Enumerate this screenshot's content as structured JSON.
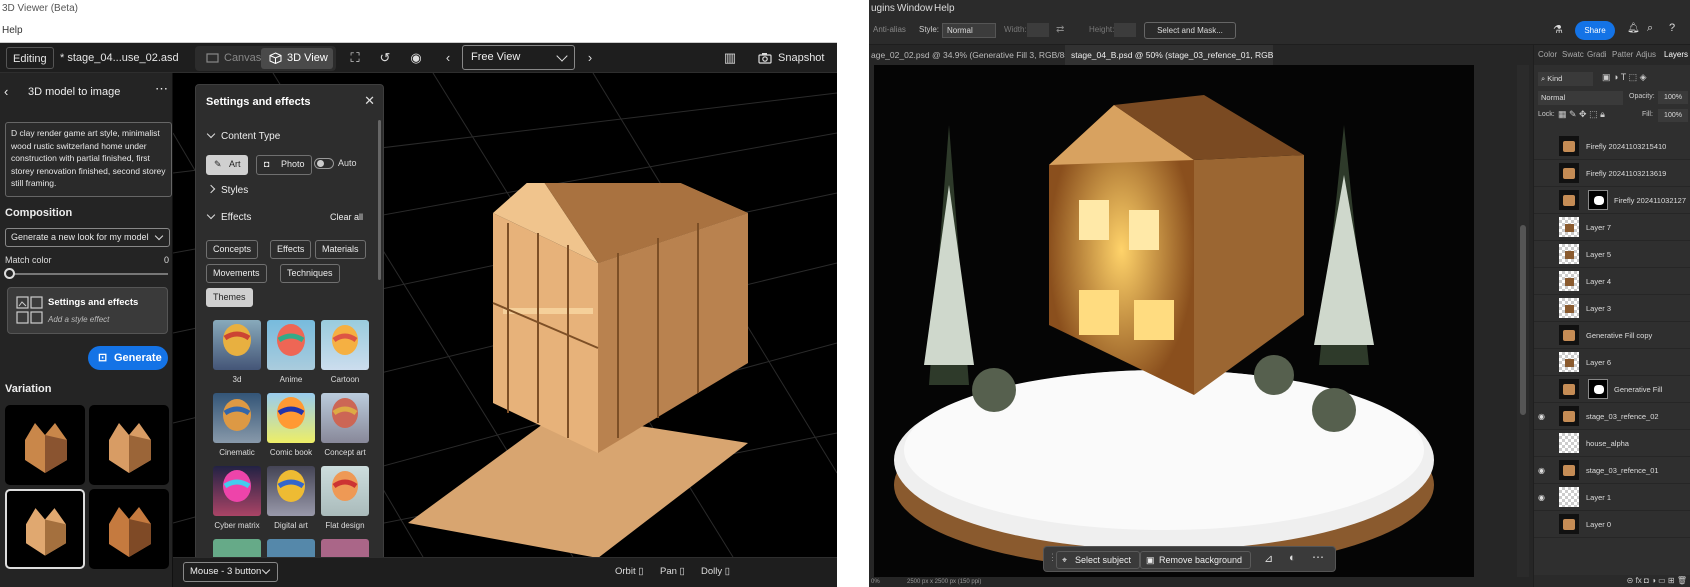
{
  "left_app": {
    "window_title": "3D Viewer (Beta)",
    "menu": [
      "Help"
    ],
    "toolbar": {
      "mode_label": "Editing",
      "file_name": "* stage_04...use_02.asd",
      "canvas_label": "Canvas",
      "view3d_label": "3D View",
      "camera_view": "Free View",
      "snapshot_label": "Snapshot"
    },
    "panel": {
      "title": "3D model to image",
      "prompt": "D clay render game art style, minimalist wood rustic switzerland home under construction with partial finished, first storey renovation finished, second storey still framing.",
      "composition_title": "Composition",
      "composition_select": "Generate a new look for my model",
      "match_color_label": "Match color",
      "match_color_value": "0",
      "settings_card_title": "Settings and effects",
      "settings_card_sub": "Add a style effect",
      "generate_label": "Generate",
      "variation_title": "Variation"
    },
    "settings_popup": {
      "title": "Settings and effects",
      "content_type_title": "Content Type",
      "art_label": "Art",
      "photo_label": "Photo",
      "auto_label": "Auto",
      "styles_title": "Styles",
      "effects_title": "Effects",
      "clear_all_label": "Clear all",
      "effect_chips": [
        "Concepts",
        "Effects",
        "Materials",
        "Movements",
        "Techniques",
        "Themes"
      ],
      "tiles": [
        {
          "label": "3d"
        },
        {
          "label": "Anime"
        },
        {
          "label": "Cartoon"
        },
        {
          "label": "Cinematic"
        },
        {
          "label": "Comic book"
        },
        {
          "label": "Concept art"
        },
        {
          "label": "Cyber matrix"
        },
        {
          "label": "Digital art"
        },
        {
          "label": "Flat design"
        }
      ]
    },
    "bottom": {
      "input_select": "Mouse - 3 button",
      "orbit_label": "Orbit",
      "pan_label": "Pan",
      "dolly_label": "Dolly"
    }
  },
  "right_app": {
    "menu": [
      "ugins",
      "Window",
      "Help"
    ],
    "options": {
      "anti_alias": "Anti-alias",
      "style_label": "Style:",
      "style_value": "Normal",
      "width_label": "Width:",
      "height_label": "Height:",
      "select_mask_label": "Select and Mask...",
      "share_label": "Share"
    },
    "doc_tabs": [
      "age_02_02.psd @ 34.9% (Generative Fill 3, RGB/8#) *",
      "stage_04_B.psd @ 50% (stage_03_refence_01, RGB/8#) *"
    ],
    "context_bar": {
      "select_subject_label": "Select subject",
      "remove_background_label": "Remove background"
    },
    "status": {
      "zoom": "0%",
      "doc_size": "2500 px x 2500 px (150 ppi)"
    },
    "layers_panel": {
      "tabs": [
        "Color",
        "Swatc",
        "Gradi",
        "Patter",
        "Adjus",
        "Layers"
      ],
      "kind_label": "Kind",
      "blend_mode": "Normal",
      "opacity_label": "Opacity:",
      "opacity_value": "100%",
      "lock_label": "Lock:",
      "fill_label": "Fill:",
      "fill_value": "100%",
      "layers": [
        {
          "name": "Firefly 20241103215410",
          "visible": false,
          "thumb": "house"
        },
        {
          "name": "Firefly 20241103213619",
          "visible": false,
          "thumb": "house"
        },
        {
          "name": "Firefly 202411032127",
          "visible": false,
          "thumb": "house-mask"
        },
        {
          "name": "Layer 7",
          "visible": false,
          "thumb": "checker-house"
        },
        {
          "name": "Layer 5",
          "visible": false,
          "thumb": "checker-house"
        },
        {
          "name": "Layer 4",
          "visible": false,
          "thumb": "checker-house"
        },
        {
          "name": "Layer 3",
          "visible": false,
          "thumb": "checker-house"
        },
        {
          "name": "Generative Fill copy",
          "visible": false,
          "thumb": "house"
        },
        {
          "name": "Layer 6",
          "visible": false,
          "thumb": "checker-house"
        },
        {
          "name": "Generative Fill",
          "visible": false,
          "thumb": "house-mask"
        },
        {
          "name": "stage_03_refence_02",
          "visible": true,
          "thumb": "house"
        },
        {
          "name": "house_alpha",
          "visible": false,
          "thumb": "checker"
        },
        {
          "name": "stage_03_refence_01",
          "visible": true,
          "thumb": "house"
        },
        {
          "name": "Layer 1",
          "visible": true,
          "thumb": "checker"
        },
        {
          "name": "Layer 0",
          "visible": false,
          "thumb": "house"
        }
      ]
    }
  },
  "colors": {
    "accent_blue": "#1473e6",
    "panel_bg": "#242424",
    "viewport_bg": "#000000",
    "ps_bg": "#323232"
  }
}
